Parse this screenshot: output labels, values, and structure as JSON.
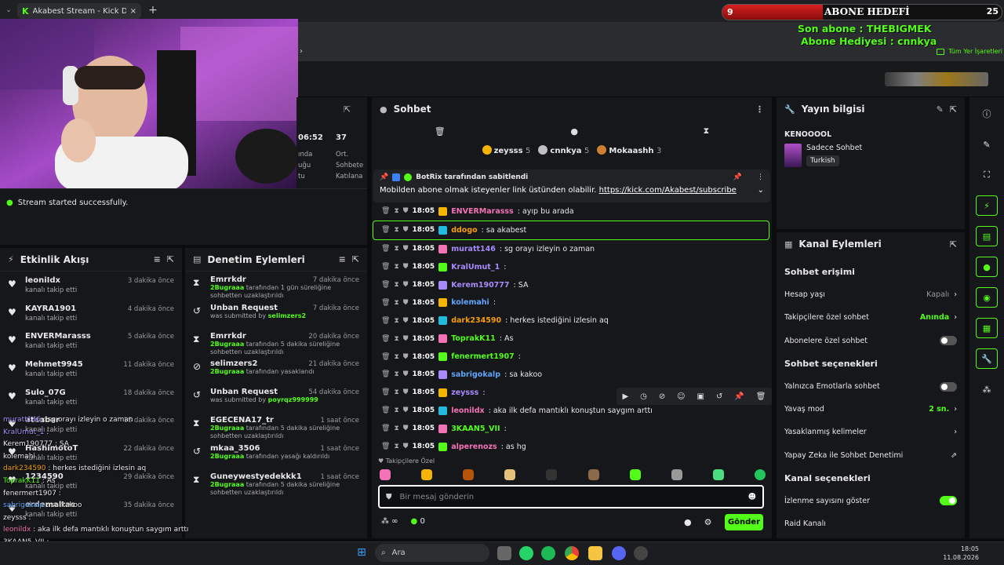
{
  "browser": {
    "tab_title": "Akabest Stream - Kick Dashboard",
    "close": "×",
    "new_tab": "+"
  },
  "overlay": {
    "goal_count": "9",
    "goal_label": "ABONE HEDEFİ",
    "goal_target": "25",
    "goal_progress": 0.36,
    "last_sub": "Son abone : THEBIGMEK",
    "gift_sub": "Abone Hediyesi : cnnkya",
    "bookmarks": "Tüm Yer İşaretleri",
    "chat_lines": [
      {
        "user": "muratt146",
        "text": " : sg orayı izleyin o zaman",
        "color": "#a78bfa"
      },
      {
        "user": "KralUmut_1",
        "text": " : ",
        "color": "#a78bfa"
      },
      {
        "user": "Kerem190777",
        "text": " : SA",
        "color": "#e8e8e8"
      },
      {
        "user": "kolemahi",
        "text": " : ",
        "color": "#e8e8e8"
      },
      {
        "user": "dark234590",
        "text": " : herkes istediğini izlesin aq",
        "color": "#f59e0b"
      },
      {
        "user": "ToprakK11",
        "text": " : As",
        "color": "#53fc18"
      },
      {
        "user": "fenermert1907",
        "text": " : ",
        "color": "#e8e8e8"
      },
      {
        "user": "sabrigokalp",
        "text": " : sa kakoo",
        "color": "#60a5fa"
      },
      {
        "user": "zeysss",
        "text": " : ",
        "color": "#e8e8e8"
      },
      {
        "user": "leonildx",
        "text": " : aka ilk defa mantıklı konuştun saygım arttı",
        "color": "#f472b6"
      },
      {
        "user": "3KAAN5_VII",
        "text": " : ",
        "color": "#e8e8e8"
      },
      {
        "user": "alperenozs",
        "text": " : as hg",
        "color": "#f472b6"
      }
    ]
  },
  "stats": {
    "time": "06:52",
    "viewers": "37",
    "l1": "ında",
    "l2": "uğu",
    "l3": "tu",
    "r1": "Ort.",
    "r2": "Sohbete",
    "r3": "Katılana"
  },
  "stream_status": "Stream started successfully.",
  "activity": {
    "title": "Etkinlik Akışı",
    "items": [
      {
        "name": "leoniIdx",
        "sub": "kanalı takip etti",
        "time": "3 dakika önce"
      },
      {
        "name": "KAYRA1901",
        "sub": "kanalı takip etti",
        "time": "4 dakika önce"
      },
      {
        "name": "ENVERMarasss",
        "sub": "kanalı takip etti",
        "time": "5 dakika önce"
      },
      {
        "name": "Mehmet9945",
        "sub": "kanalı takip etti",
        "time": "11 dakika önce"
      },
      {
        "name": "Sulo_07G",
        "sub": "kanalı takip etti",
        "time": "18 dakika önce"
      },
      {
        "name": "ataabar",
        "sub": "kanalı takip etti",
        "time": "18 dakika önce"
      },
      {
        "name": "HashimotoT",
        "sub": "kanalı takip etti",
        "time": "22 dakika önce"
      },
      {
        "name": "1234590",
        "sub": "kanalı takip etti",
        "time": "29 dakika önce"
      },
      {
        "name": "erdemaltas",
        "sub": "kanalı takip etti",
        "time": "35 dakika önce"
      }
    ]
  },
  "moderation": {
    "title": "Denetim Eylemleri",
    "items": [
      {
        "icon": "timeout",
        "name": "Emrrkdr",
        "by": "2Bugraaa",
        "rest": " tarafından 1 gün süreliğine sohbetten uzaklaştırıldı",
        "time": "7 dakika önce"
      },
      {
        "icon": "unban",
        "name": "Unban Request",
        "by": "",
        "rest": "was submitted by ",
        "extra": "selimzers2",
        "time": "7 dakika önce"
      },
      {
        "icon": "timeout",
        "name": "Emrrkdr",
        "by": "2Bugraaa",
        "rest": " tarafından 5 dakika süreliğine sohbetten uzaklaştırıldı",
        "time": "20 dakika önce"
      },
      {
        "icon": "ban",
        "name": "selimzers2",
        "by": "2Bugraaa",
        "rest": " tarafından yasaklandı",
        "time": "21 dakika önce"
      },
      {
        "icon": "unban",
        "name": "Unban Request",
        "by": "",
        "rest": "was submitted by ",
        "extra": "poyrqz999999",
        "time": "54 dakika önce"
      },
      {
        "icon": "timeout",
        "name": "EGECENA17_tr",
        "by": "2Bugraaa",
        "rest": " tarafından 5 dakika süreliğine sohbetten uzaklaştırıldı",
        "time": "1 saat önce"
      },
      {
        "icon": "unban",
        "name": "mkaa_3506",
        "by": "2Bugraaa",
        "rest": " tarafından yasağı kaldırıldı",
        "time": "1 saat önce"
      },
      {
        "icon": "timeout",
        "name": "Guneywestyedekkk1",
        "by": "2Bugraaa",
        "rest": " tarafından 5 dakika süreliğine sohbetten uzaklaştırıldı",
        "time": "1 saat önce"
      }
    ]
  },
  "chat": {
    "title": "Sohbet",
    "top": [
      {
        "name": "zeysss",
        "count": "5",
        "color": "#f5b400"
      },
      {
        "name": "cnnkya",
        "count": "5",
        "color": "#c0c0c0"
      },
      {
        "name": "Mokaashh",
        "count": "3",
        "color": "#cd7f32"
      }
    ],
    "pinned_by": "BotRix tarafından sabitlendi",
    "pinned_text": "Mobilden abone olmak isteyenler link üstünden olabilir. ",
    "pinned_link": "https://kick.com/Akabest/subscribe",
    "messages": [
      {
        "time": "18:05",
        "user": "ENVERMarasss",
        "color": "#f472b6",
        "text": ": ayıp bu arada"
      },
      {
        "time": "18:05",
        "user": "ddogo",
        "color": "#f59e0b",
        "text": ": sa akabest",
        "hl": true
      },
      {
        "time": "18:05",
        "user": "muratt146",
        "color": "#a78bfa",
        "text": ": sg orayı izleyin o zaman"
      },
      {
        "time": "18:05",
        "user": "KralUmut_1",
        "color": "#a78bfa",
        "text": ":"
      },
      {
        "time": "18:05",
        "user": "Kerem190777",
        "color": "#a78bfa",
        "text": ": SA"
      },
      {
        "time": "18:05",
        "user": "kolemahi",
        "color": "#60a5fa",
        "text": ":"
      },
      {
        "time": "18:05",
        "user": "dark234590",
        "color": "#f59e0b",
        "text": ": herkes istediğini izlesin aq"
      },
      {
        "time": "18:05",
        "user": "ToprakK11",
        "color": "#53fc18",
        "text": ": As"
      },
      {
        "time": "18:05",
        "user": "fenermert1907",
        "color": "#53fc18",
        "text": ":"
      },
      {
        "time": "18:05",
        "user": "sabrigokalp",
        "color": "#60a5fa",
        "text": ": sa kakoo"
      },
      {
        "time": "18:05",
        "user": "zeysss",
        "color": "#a78bfa",
        "text": ":"
      },
      {
        "time": "18:05",
        "user": "leonildx",
        "color": "#f472b6",
        "text": ": aka ilk defa mantıklı konuştun saygım arttı"
      },
      {
        "time": "18:05",
        "user": "3KAAN5_VII",
        "color": "#53fc18",
        "text": ":"
      },
      {
        "time": "18:05",
        "user": "alperenozs",
        "color": "#f472b6",
        "text": ": as hg"
      }
    ],
    "followers_only": "Takipçilere Özel",
    "placeholder": "Bir mesaj gönderin",
    "points": "0",
    "send": "Gönder"
  },
  "info": {
    "title": "Yayın bilgisi",
    "stream_title": "KENOOOOL",
    "category": "Sadece Sohbet",
    "tag": "Turkish"
  },
  "actions": {
    "title": "Kanal Eylemleri",
    "rows": [
      {
        "type": "section",
        "label": "Sohbet erişimi"
      },
      {
        "type": "value",
        "label": "Hesap yaşı",
        "value": "Kapalı"
      },
      {
        "type": "green",
        "label": "Takipçilere özel sohbet",
        "value": "Anında"
      },
      {
        "type": "toggle",
        "label": "Abonelere özel sohbet",
        "on": false
      },
      {
        "type": "section",
        "label": "Sohbet seçenekleri"
      },
      {
        "type": "toggle",
        "label": "Yalnızca Emotlarla sohbet",
        "on": false
      },
      {
        "type": "green",
        "label": "Yavaş mod",
        "value": "2 sn."
      },
      {
        "type": "value",
        "label": "Yasaklanmış kelimeler",
        "value": ""
      },
      {
        "type": "ext",
        "label": "Yapay Zeka ile Sohbet Denetimi",
        "value": ""
      },
      {
        "type": "section",
        "label": "Kanal seçenekleri"
      },
      {
        "type": "toggle",
        "label": "İzlenme sayısını göster",
        "on": true
      },
      {
        "type": "plain",
        "label": "Raid Kanalı"
      }
    ]
  },
  "taskbar": {
    "search": "Ara",
    "time": "18:05",
    "date": "11.08.2026"
  }
}
